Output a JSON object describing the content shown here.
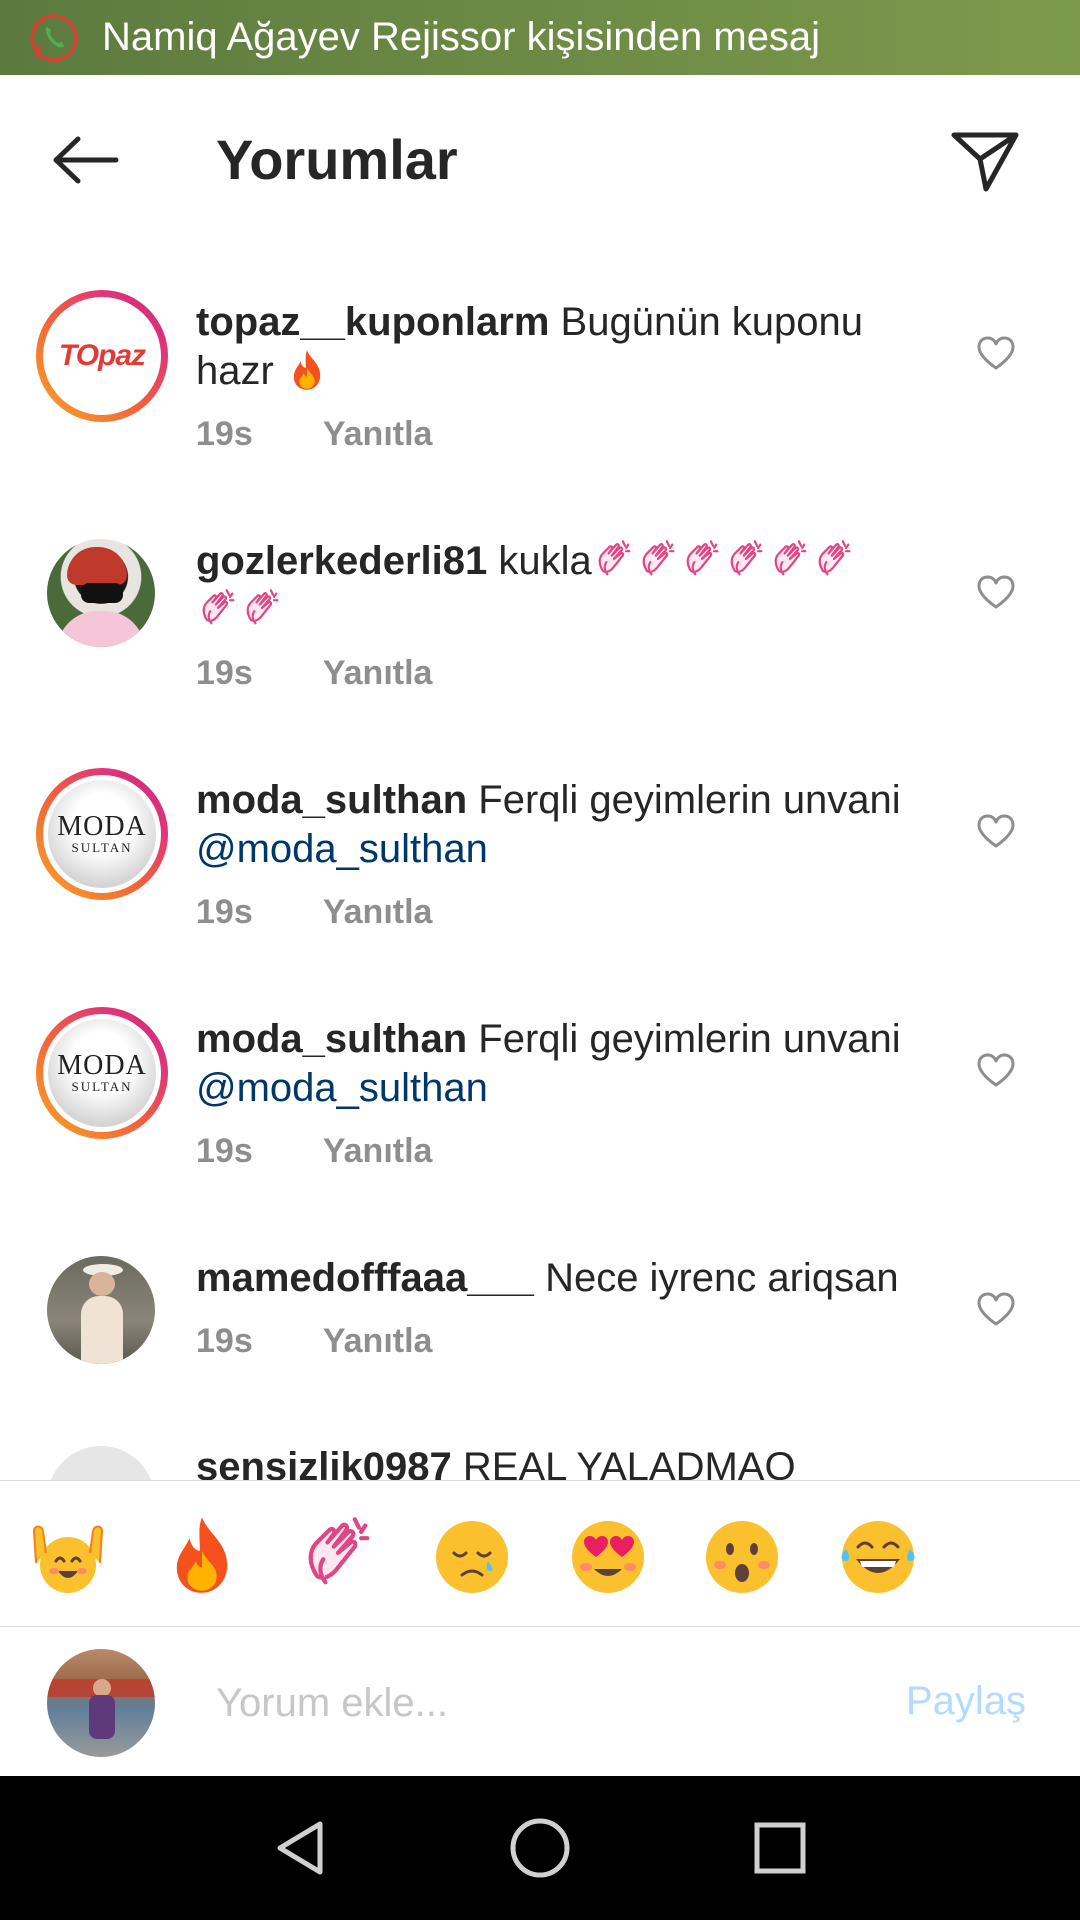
{
  "notification": {
    "text": "Namiq Ağayev Rejissor kişisinden mesaj",
    "app_icon": "whatsapp-icon"
  },
  "header": {
    "title": "Yorumlar",
    "back_icon": "back-arrow-icon",
    "share_icon": "paper-plane-icon"
  },
  "comments": [
    {
      "username": "topaz__kuponlarm",
      "text": "Bugünün kuponu hazr",
      "trailing_emoji": "fire",
      "time": "19s",
      "reply": "Yanıtla",
      "avatar": "topaz-logo"
    },
    {
      "username": "gozlerkederli81",
      "text": "kukla",
      "trailing_emoji": "clapping-hands x8",
      "time": "19s",
      "reply": "Yanıtla",
      "avatar": "user-photo"
    },
    {
      "username": "moda_sulthan",
      "text": "Ferqli geyimlerin unvani",
      "mention": "@moda_sulthan",
      "time": "19s",
      "reply": "Yanıtla",
      "avatar": "moda-sultan-logo"
    },
    {
      "username": "moda_sulthan",
      "text": "Ferqli geyimlerin unvani",
      "mention": "@moda_sulthan",
      "time": "19s",
      "reply": "Yanıtla",
      "avatar": "moda-sultan-logo"
    },
    {
      "username": "mamedofffaaa___",
      "text": "Nece iyrenc ariqsan",
      "time": "19s",
      "reply": "Yanıtla",
      "avatar": "user-photo"
    },
    {
      "username": "sensizlik0987",
      "text": "REAL YALADMAQ",
      "avatar": "default-avatar"
    }
  ],
  "avatar_text": {
    "topaz": "TOpaz",
    "moda": "MODA",
    "moda_sub": "SULTAN"
  },
  "emoji_bar": [
    "raising-hands",
    "fire",
    "clapping-hands",
    "crying-face",
    "heart-eyes",
    "surprised-face",
    "tears-of-joy"
  ],
  "composer": {
    "placeholder": "Yorum ekle...",
    "post_label": "Paylaş"
  },
  "nav": [
    "back-triangle-icon",
    "home-circle-icon",
    "recents-square-icon"
  ],
  "colors": {
    "accent_blue": "#00376b",
    "post_disabled": "#b3dbff",
    "meta_gray": "#8e8e8e",
    "banner_green": "#6d8a45"
  }
}
